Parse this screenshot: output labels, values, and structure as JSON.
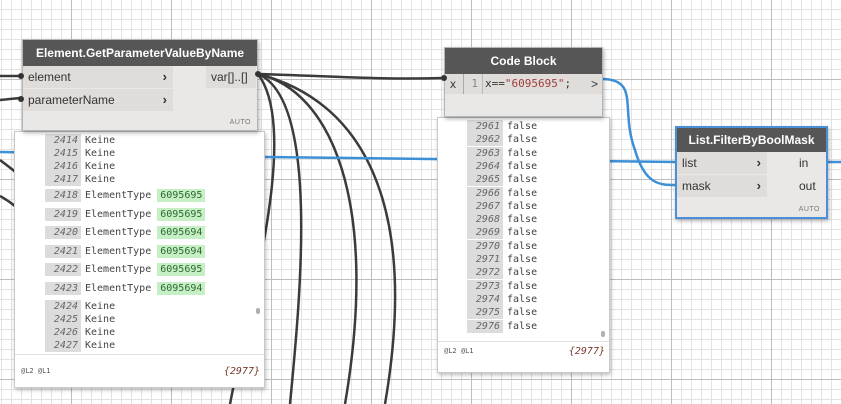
{
  "colors": {
    "wire_dark": "#3b3b3b",
    "wire_blue": "#3d8fd6",
    "node_header": "#565656",
    "selected_border": "#4a90d9"
  },
  "get_param_node": {
    "title": "Element.GetParameterValueByName",
    "inputs": [
      "element",
      "parameterName"
    ],
    "output": "var[]..[]",
    "auto": "AUTO",
    "preview": {
      "rows": [
        {
          "index": "2414",
          "text": "Keine",
          "value": ""
        },
        {
          "index": "2415",
          "text": "Keine",
          "value": ""
        },
        {
          "index": "2416",
          "text": "Keine",
          "value": ""
        },
        {
          "index": "2417",
          "text": "Keine",
          "value": ""
        },
        {
          "index": "2418",
          "text": "ElementType",
          "value": "6095695"
        },
        {
          "index": "2419",
          "text": "ElementType",
          "value": "6095695"
        },
        {
          "index": "2420",
          "text": "ElementType",
          "value": "6095694"
        },
        {
          "index": "2421",
          "text": "ElementType",
          "value": "6095694"
        },
        {
          "index": "2422",
          "text": "ElementType",
          "value": "6095695"
        },
        {
          "index": "2423",
          "text": "ElementType",
          "value": "6095694"
        },
        {
          "index": "2424",
          "text": "Keine",
          "value": ""
        },
        {
          "index": "2425",
          "text": "Keine",
          "value": ""
        },
        {
          "index": "2426",
          "text": "Keine",
          "value": ""
        },
        {
          "index": "2427",
          "text": "Keine",
          "value": ""
        }
      ],
      "levels": "@L2 @L1",
      "count": "{2977}"
    }
  },
  "code_block": {
    "title": "Code Block",
    "input": "x",
    "line_number": "1",
    "code_prefix": "x==",
    "code_string": "\"6095695\"",
    "code_suffix": ";",
    "output": ">",
    "preview": {
      "rows": [
        {
          "index": "2961",
          "text": "false"
        },
        {
          "index": "2962",
          "text": "false"
        },
        {
          "index": "2963",
          "text": "false"
        },
        {
          "index": "2964",
          "text": "false"
        },
        {
          "index": "2965",
          "text": "false"
        },
        {
          "index": "2966",
          "text": "false"
        },
        {
          "index": "2967",
          "text": "false"
        },
        {
          "index": "2968",
          "text": "false"
        },
        {
          "index": "2969",
          "text": "false"
        },
        {
          "index": "2970",
          "text": "false"
        },
        {
          "index": "2971",
          "text": "false"
        },
        {
          "index": "2972",
          "text": "false"
        },
        {
          "index": "2973",
          "text": "false"
        },
        {
          "index": "2974",
          "text": "false"
        },
        {
          "index": "2975",
          "text": "false"
        },
        {
          "index": "2976",
          "text": "false"
        }
      ],
      "levels": "@L2 @L1",
      "count": "{2977}"
    }
  },
  "filter_node": {
    "title": "List.FilterByBoolMask",
    "inputs": [
      "list",
      "mask"
    ],
    "outputs": [
      "in",
      "out"
    ],
    "auto": "AUTO"
  }
}
